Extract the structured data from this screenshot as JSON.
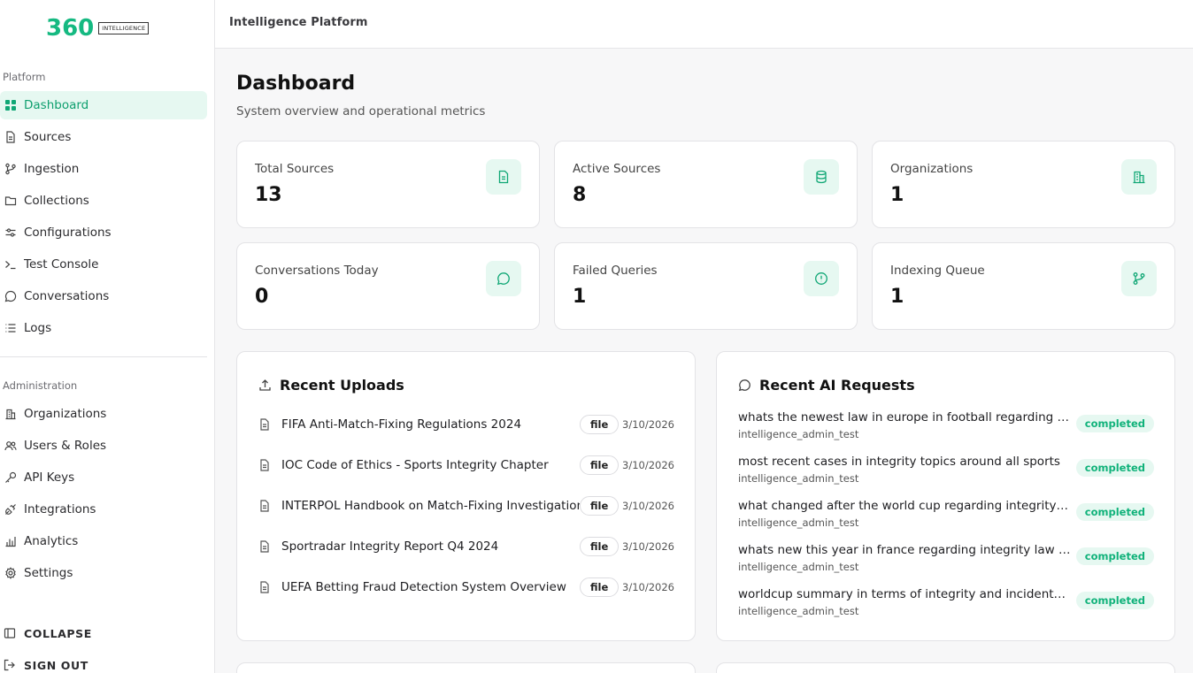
{
  "brand": {
    "logo_number": "360",
    "logo_badge": "INTELLIGENCE",
    "accent": "#15b981"
  },
  "sidebar": {
    "platform_label": "Platform",
    "platform_items": [
      {
        "label": "Dashboard",
        "icon": "grid-icon",
        "active": true
      },
      {
        "label": "Sources",
        "icon": "file-icon"
      },
      {
        "label": "Ingestion",
        "icon": "git-branch-icon"
      },
      {
        "label": "Collections",
        "icon": "folder-icon"
      },
      {
        "label": "Configurations",
        "icon": "sliders-icon"
      },
      {
        "label": "Test Console",
        "icon": "terminal-icon"
      },
      {
        "label": "Conversations",
        "icon": "message-icon"
      },
      {
        "label": "Logs",
        "icon": "list-icon"
      }
    ],
    "admin_label": "Administration",
    "admin_items": [
      {
        "label": "Organizations",
        "icon": "building-icon"
      },
      {
        "label": "Users & Roles",
        "icon": "users-icon"
      },
      {
        "label": "API Keys",
        "icon": "key-icon"
      },
      {
        "label": "Integrations",
        "icon": "plug-icon"
      },
      {
        "label": "Analytics",
        "icon": "bar-chart-icon"
      },
      {
        "label": "Settings",
        "icon": "gear-icon"
      }
    ],
    "collapse_label": "COLLAPSE",
    "signout_label": "SIGN OUT"
  },
  "topbar": {
    "title": "Intelligence Platform"
  },
  "page": {
    "title": "Dashboard",
    "subtitle": "System overview and operational metrics"
  },
  "stats": [
    {
      "label": "Total Sources",
      "value": "13",
      "icon": "file-text-icon"
    },
    {
      "label": "Active Sources",
      "value": "8",
      "icon": "database-icon"
    },
    {
      "label": "Organizations",
      "value": "1",
      "icon": "building-icon"
    },
    {
      "label": "Conversations Today",
      "value": "0",
      "icon": "message-icon"
    },
    {
      "label": "Failed Queries",
      "value": "1",
      "icon": "alert-circle-icon"
    },
    {
      "label": "Indexing Queue",
      "value": "1",
      "icon": "git-branch-icon"
    }
  ],
  "recent_uploads": {
    "title": "Recent Uploads",
    "items": [
      {
        "name": "FIFA Anti-Match-Fixing Regulations 2024",
        "type": "file",
        "date": "3/10/2026"
      },
      {
        "name": "IOC Code of Ethics - Sports Integrity Chapter",
        "type": "file",
        "date": "3/10/2026"
      },
      {
        "name": "INTERPOL Handbook on Match-Fixing Investigation",
        "type": "file",
        "date": "3/10/2026"
      },
      {
        "name": "Sportradar Integrity Report Q4 2024",
        "type": "file",
        "date": "3/10/2026"
      },
      {
        "name": "UEFA Betting Fraud Detection System Overview",
        "type": "file",
        "date": "3/10/2026"
      }
    ]
  },
  "recent_requests": {
    "title": "Recent AI Requests",
    "items": [
      {
        "query": "whats the newest law in europe in football regarding integrity",
        "user": "intelligence_admin_test",
        "status": "completed"
      },
      {
        "query": "most recent cases in integrity topics around all sports",
        "user": "intelligence_admin_test",
        "status": "completed"
      },
      {
        "query": "what changed after the world cup regarding integrity and regulations",
        "user": "intelligence_admin_test",
        "status": "completed"
      },
      {
        "query": "whats new this year in france regarding integrity law and cases",
        "user": "intelligence_admin_test",
        "status": "completed"
      },
      {
        "query": "worldcup summary in terms of integrity and incidents and findings",
        "user": "intelligence_admin_test",
        "status": "completed"
      }
    ]
  }
}
